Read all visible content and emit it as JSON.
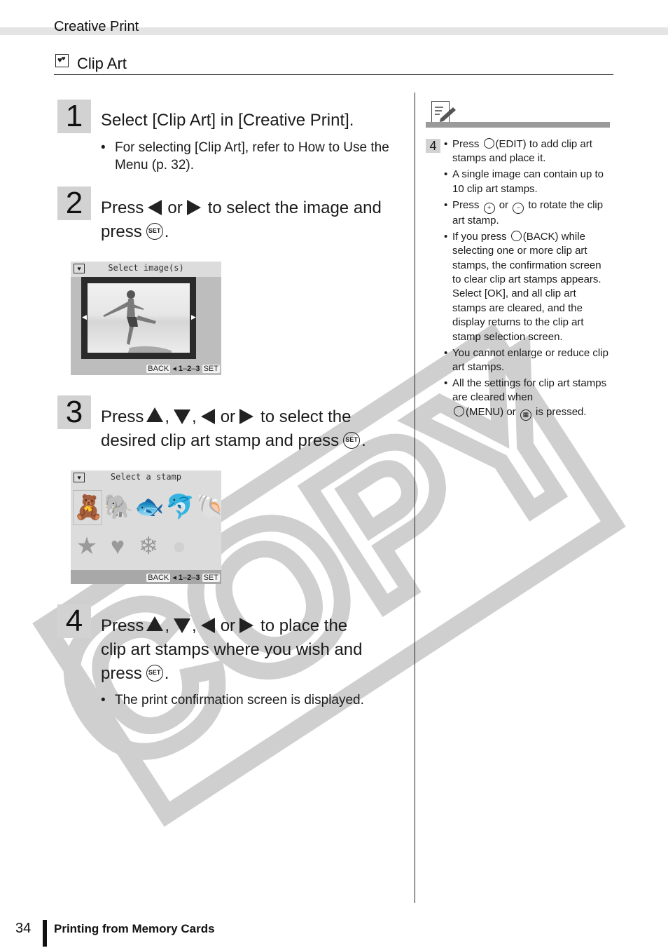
{
  "header": {
    "section": "Creative Print",
    "title": "Clip Art",
    "title_icon": "clip-art-hearts-icon"
  },
  "steps": [
    {
      "number": "1",
      "text": "Select [Clip Art] in [Creative Print].",
      "bullets": [
        "For selecting [Clip Art], refer to How to Use the Menu (p. 32)."
      ]
    },
    {
      "number": "2",
      "text_parts": [
        "Press",
        "or",
        "to select the image and",
        "press",
        "."
      ],
      "screen": {
        "title": "Select image(s)",
        "footer": [
          "BACK",
          "1",
          "2",
          "3",
          "SET"
        ]
      }
    },
    {
      "number": "3",
      "text_parts": [
        "Press",
        ",",
        ",",
        "or",
        "to select the",
        "desired clip art stamp and press",
        "."
      ],
      "screen": {
        "title": "Select a stamp",
        "stamps": [
          "teddy-bear",
          "elephant",
          "sunfish",
          "dolphin",
          "seashell",
          "star",
          "heart",
          "snowflake",
          "circle"
        ],
        "footer": [
          "BACK",
          "1",
          "2",
          "3",
          "SET"
        ]
      }
    },
    {
      "number": "4",
      "text_parts": [
        "Press",
        ",",
        ",",
        "or",
        "to place the",
        "clip art stamps where you wish and",
        "press",
        "."
      ],
      "bullets": [
        "The print confirmation screen is displayed."
      ]
    }
  ],
  "note": {
    "icon": "note-pencil-icon",
    "step_ref": "4",
    "items": [
      {
        "pre": "Press",
        "button": "(EDIT)",
        "post": "to add clip art stamps and place it."
      },
      {
        "text": "A single image can contain up to 10 clip art stamps."
      },
      {
        "pre": "Press",
        "mid": "or",
        "post": "to rotate the clip art stamp."
      },
      {
        "pre": "If you press",
        "button": "(BACK)",
        "post": "while selecting one or more clip art stamps, the confirmation screen to clear clip art stamps appears. Select [OK], and all clip art stamps are cleared, and the display returns to the clip art stamp selection screen."
      },
      {
        "text": "You cannot enlarge or reduce clip art stamps."
      },
      {
        "pre": "All the settings for clip art stamps are cleared when",
        "button": "(MENU)",
        "mid": "or",
        "post": "is pressed."
      }
    ]
  },
  "watermark": "COPY",
  "footer": {
    "page_number": "34",
    "chapter": "Printing from Memory Cards"
  }
}
